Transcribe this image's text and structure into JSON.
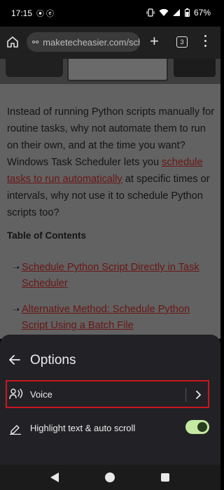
{
  "status_bar": {
    "time": "17:15",
    "left_icons": "⦿ ⓔ",
    "battery": "67%"
  },
  "browser": {
    "url": "maketecheasier.com/sch",
    "tab_count": "3"
  },
  "article": {
    "para_1": "Instead of running Python scripts manually for routine tasks, why not automate them to run on their own, and at the time you want? Windows Task Scheduler lets you ",
    "para_link": "schedule tasks to run automatically",
    "para_2": " at specific times or intervals, why not use it to schedule Python scripts too?",
    "toc_heading": "Table of Contents",
    "toc_items": [
      "Schedule Python Script Directly in Task Scheduler",
      "Alternative Method: Schedule Python Script Using a Batch File"
    ]
  },
  "options_sheet": {
    "title": "Options",
    "voice_label": "Voice",
    "highlight_label": "Highlight text & auto scroll",
    "highlight_enabled": true,
    "accent_color": "#c5e8a2",
    "focus_border_color": "#c9171e"
  },
  "icons": {
    "home": "home-icon",
    "tune": "tune-icon",
    "new_tab": "plus-icon",
    "tabs": "tab-switcher-icon",
    "menu": "more-vert-icon",
    "back": "arrow-back-icon",
    "voice": "voice-icon",
    "chevron": "chevron-right-icon",
    "highlight": "highlight-pen-icon"
  }
}
